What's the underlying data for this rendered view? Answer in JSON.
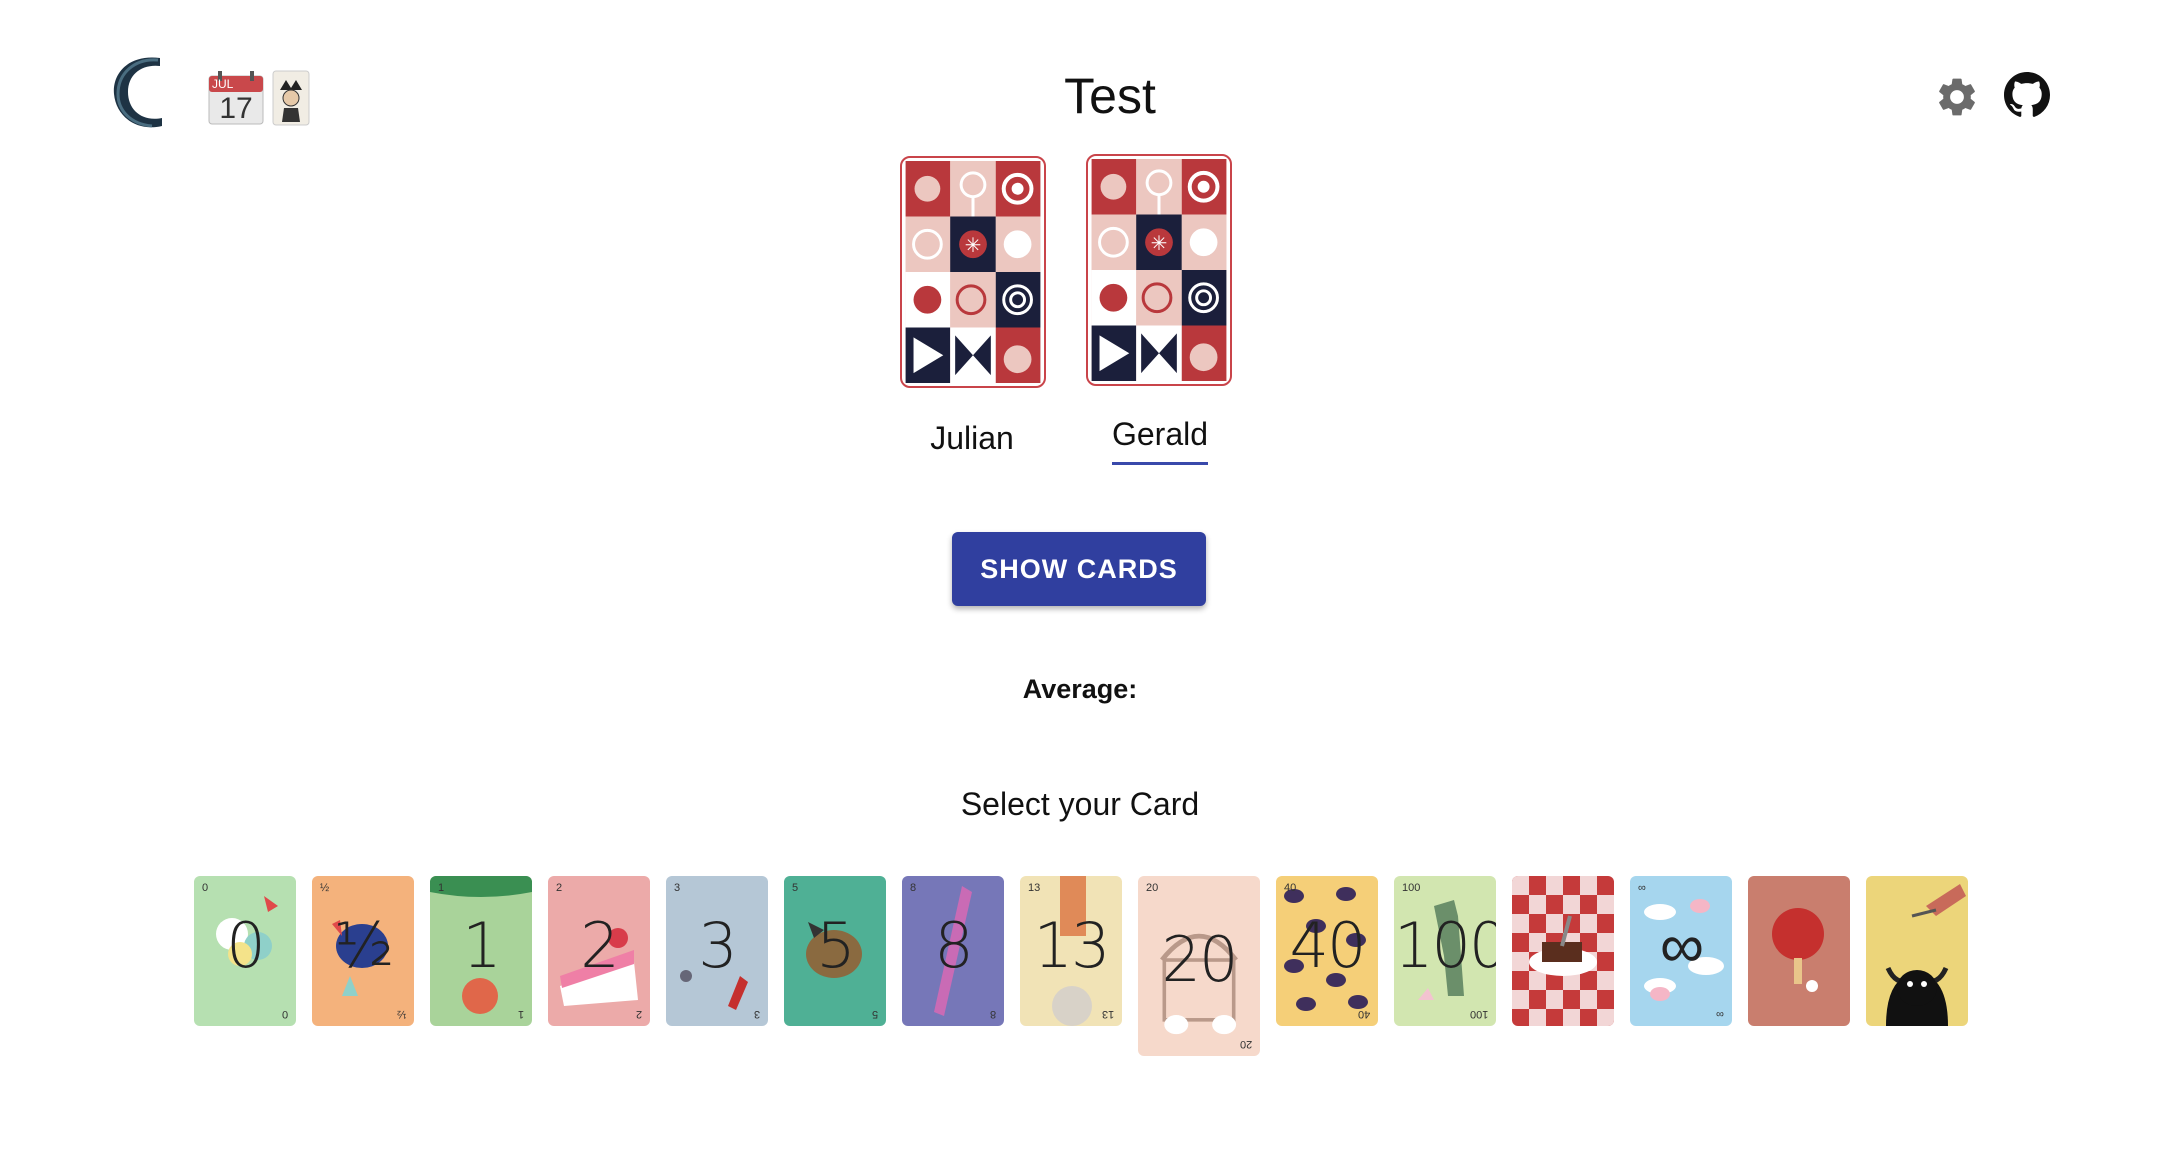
{
  "header": {
    "title": "Test",
    "calendar": {
      "month": "JUL",
      "day": "17"
    },
    "icons": [
      "logo-icon",
      "calendar-icon",
      "jester-icon",
      "gear-icon",
      "github-icon"
    ]
  },
  "players": [
    {
      "name": "Julian",
      "underlined": false
    },
    {
      "name": "Gerald",
      "underlined": true
    }
  ],
  "show_button_label": "SHOW CARDS",
  "average_label": "Average:",
  "select_title": "Select your Card",
  "deck": [
    {
      "value": "0",
      "color": "#b6e0b1"
    },
    {
      "value": "½",
      "color": "#f4b27c"
    },
    {
      "value": "1",
      "color": "#a9d39a"
    },
    {
      "value": "2",
      "color": "#ecaaa9"
    },
    {
      "value": "3",
      "color": "#b5c7d6"
    },
    {
      "value": "5",
      "color": "#4fb095"
    },
    {
      "value": "8",
      "color": "#7677b8"
    },
    {
      "value": "13",
      "color": "#f1e3b6"
    },
    {
      "value": "20",
      "color": "#f6d9cb",
      "selected": true
    },
    {
      "value": "40",
      "color": "#f5cf78"
    },
    {
      "value": "100",
      "color": "#d2e6b0"
    },
    {
      "value": "",
      "color": "#c53a3a",
      "icon": "brownie-icon"
    },
    {
      "value": "∞",
      "color": "#a6d6ee"
    },
    {
      "value": "",
      "color": "#c97e6e",
      "icon": "ping-pong-icon"
    },
    {
      "value": "",
      "color": "#ecd57a",
      "icon": "bull-icon"
    }
  ],
  "colors": {
    "primary": "#303f9f",
    "card_back_red": "#b9383c",
    "card_back_navy": "#1b1f3b",
    "card_back_pink": "#ecc7c0"
  }
}
